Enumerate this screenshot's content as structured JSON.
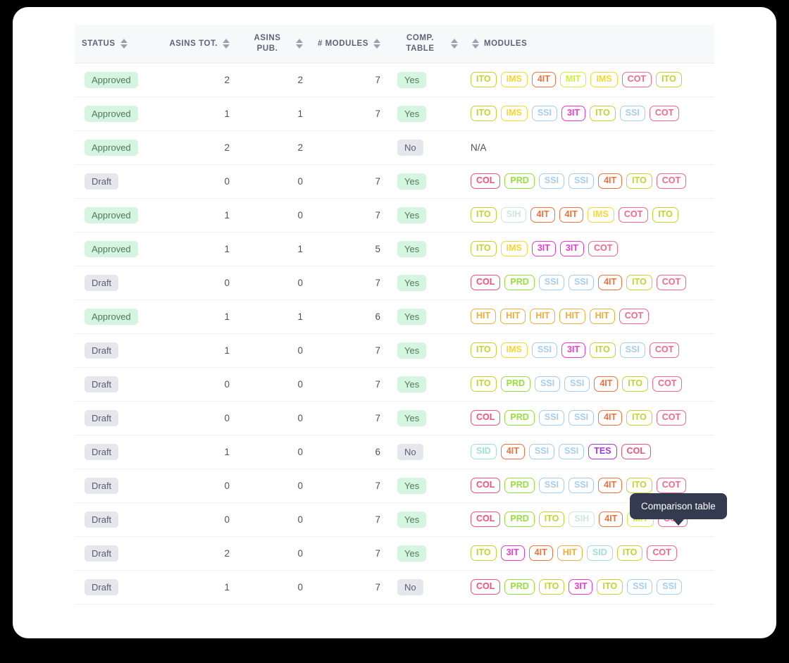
{
  "colors": {
    "ITO": "#c3d42e",
    "IMS": "#f7d632",
    "4IT": "#f4713c",
    "MIT": "#d3ee36",
    "COT": "#f5668c",
    "SSI": "#a4cdf0",
    "3IT": "#f038d0",
    "COL": "#f25277",
    "PRD": "#96e03c",
    "SIH": "#c9ead8",
    "HIT": "#f0ad3c",
    "SID": "#9fdfd9",
    "TES": "#a339d6"
  },
  "table": {
    "columns": [
      {
        "label": "STATUS",
        "sortable": true,
        "align": "left",
        "name": "status"
      },
      {
        "label": "ASINS TOT.",
        "sortable": true,
        "align": "right",
        "name": "asins-tot"
      },
      {
        "label": "ASINS PUB.",
        "sortable": true,
        "align": "right",
        "name": "asins-pub"
      },
      {
        "label": "# MODULES",
        "sortable": true,
        "align": "right",
        "name": "num-modules"
      },
      {
        "label": "COMP. TABLE",
        "sortable": true,
        "align": "left",
        "name": "comp-table"
      },
      {
        "label": "MODULES",
        "sortable": false,
        "align": "left",
        "name": "modules"
      }
    ],
    "rows": [
      {
        "status": "Approved",
        "asins_tot": "2",
        "asins_pub": "2",
        "num_modules": "7",
        "comp_table": "Yes",
        "modules": [
          "ITO",
          "IMS",
          "4IT",
          "MIT",
          "IMS",
          "COT",
          "ITO"
        ]
      },
      {
        "status": "Approved",
        "asins_tot": "1",
        "asins_pub": "1",
        "num_modules": "7",
        "comp_table": "Yes",
        "modules": [
          "ITO",
          "IMS",
          "SSI",
          "3IT",
          "ITO",
          "SSI",
          "COT"
        ]
      },
      {
        "status": "Approved",
        "asins_tot": "2",
        "asins_pub": "2",
        "num_modules": "",
        "comp_table": "No",
        "modules": [],
        "modules_text": "N/A"
      },
      {
        "status": "Draft",
        "asins_tot": "0",
        "asins_pub": "0",
        "num_modules": "7",
        "comp_table": "Yes",
        "modules": [
          "COL",
          "PRD",
          "SSI",
          "SSI",
          "4IT",
          "ITO",
          "COT"
        ]
      },
      {
        "status": "Approved",
        "asins_tot": "1",
        "asins_pub": "0",
        "num_modules": "7",
        "comp_table": "Yes",
        "modules": [
          "ITO",
          "SIH",
          "4IT",
          "4IT",
          "IMS",
          "COT",
          "ITO"
        ]
      },
      {
        "status": "Approved",
        "asins_tot": "1",
        "asins_pub": "1",
        "num_modules": "5",
        "comp_table": "Yes",
        "modules": [
          "ITO",
          "IMS",
          "3IT",
          "3IT",
          "COT"
        ]
      },
      {
        "status": "Draft",
        "asins_tot": "0",
        "asins_pub": "0",
        "num_modules": "7",
        "comp_table": "Yes",
        "modules": [
          "COL",
          "PRD",
          "SSI",
          "SSI",
          "4IT",
          "ITO",
          "COT"
        ]
      },
      {
        "status": "Approved",
        "asins_tot": "1",
        "asins_pub": "1",
        "num_modules": "6",
        "comp_table": "Yes",
        "modules": [
          "HIT",
          "HIT",
          "HIT",
          "HIT",
          "HIT",
          "COT"
        ]
      },
      {
        "status": "Draft",
        "asins_tot": "1",
        "asins_pub": "0",
        "num_modules": "7",
        "comp_table": "Yes",
        "modules": [
          "ITO",
          "IMS",
          "SSI",
          "3IT",
          "ITO",
          "SSI",
          "COT"
        ]
      },
      {
        "status": "Draft",
        "asins_tot": "0",
        "asins_pub": "0",
        "num_modules": "7",
        "comp_table": "Yes",
        "modules": [
          "ITO",
          "PRD",
          "SSI",
          "SSI",
          "4IT",
          "ITO",
          "COT"
        ]
      },
      {
        "status": "Draft",
        "asins_tot": "0",
        "asins_pub": "0",
        "num_modules": "7",
        "comp_table": "Yes",
        "modules": [
          "COL",
          "PRD",
          "SSI",
          "SSI",
          "4IT",
          "ITO",
          "COT"
        ]
      },
      {
        "status": "Draft",
        "asins_tot": "1",
        "asins_pub": "0",
        "num_modules": "6",
        "comp_table": "No",
        "modules": [
          "SID",
          "4IT",
          "SSI",
          "SSI",
          "TES",
          "COL"
        ]
      },
      {
        "status": "Draft",
        "asins_tot": "0",
        "asins_pub": "0",
        "num_modules": "7",
        "comp_table": "Yes",
        "modules": [
          "COL",
          "PRD",
          "SSI",
          "SSI",
          "4IT",
          "ITO",
          "COT"
        ]
      },
      {
        "status": "Draft",
        "asins_tot": "0",
        "asins_pub": "0",
        "num_modules": "7",
        "comp_table": "Yes",
        "modules": [
          "COL",
          "PRD",
          "ITO",
          "SIH",
          "4IT",
          "MIT",
          "COT"
        ]
      },
      {
        "status": "Draft",
        "asins_tot": "2",
        "asins_pub": "0",
        "num_modules": "7",
        "comp_table": "Yes",
        "modules": [
          "ITO",
          "3IT",
          "4IT",
          "HIT",
          "SID",
          "ITO",
          "COT"
        ]
      },
      {
        "status": "Draft",
        "asins_tot": "1",
        "asins_pub": "0",
        "num_modules": "7",
        "comp_table": "No",
        "modules": [
          "COL",
          "PRD",
          "ITO",
          "3IT",
          "ITO",
          "SSI",
          "SSI"
        ]
      }
    ]
  },
  "tooltip": {
    "text": "Comparison table"
  }
}
